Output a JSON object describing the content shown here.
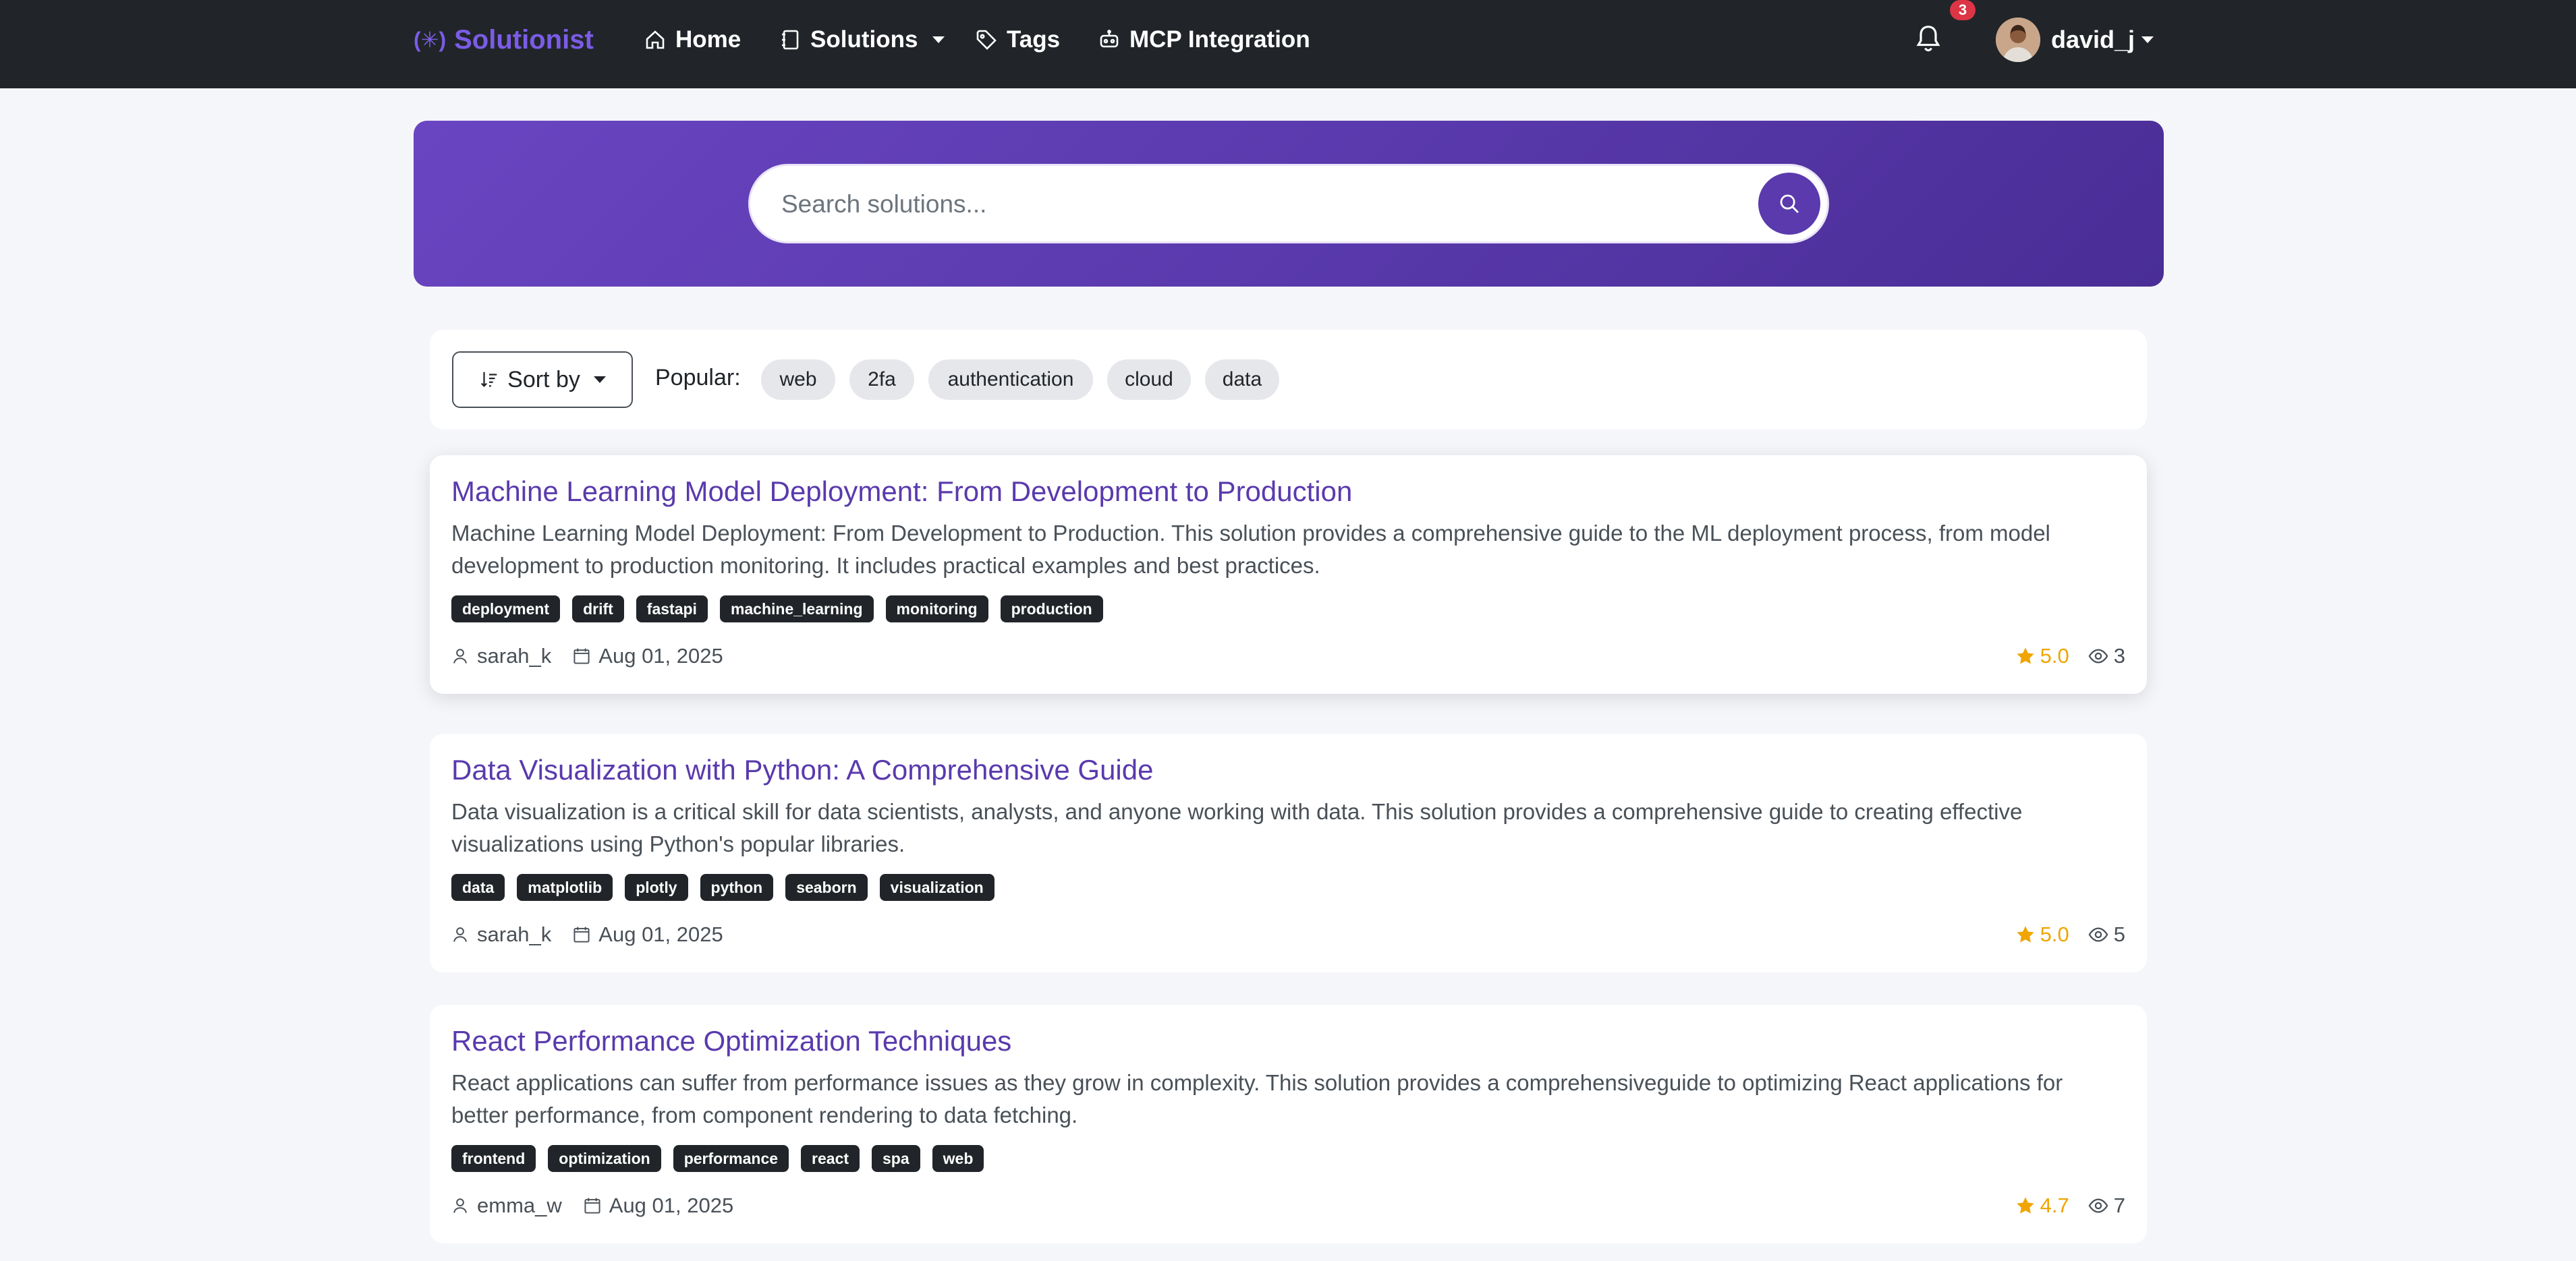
{
  "brand": {
    "name": "Solutionist"
  },
  "nav": {
    "items": [
      {
        "label": "Home",
        "icon": "home-icon"
      },
      {
        "label": "Solutions",
        "icon": "journal-icon"
      },
      {
        "label": "Tags",
        "icon": "tag-icon"
      },
      {
        "label": "MCP Integration",
        "icon": "robot-icon"
      }
    ],
    "notifications": "3",
    "username": "david_j"
  },
  "search": {
    "placeholder": "Search solutions..."
  },
  "filters": {
    "sort_label": "Sort by",
    "popular_label": "Popular:",
    "popular_tags": [
      "web",
      "2fa",
      "authentication",
      "cloud",
      "data"
    ]
  },
  "solutions": [
    {
      "title": "Machine Learning Model Deployment: From Development to Production",
      "description": "Machine Learning Model Deployment: From Development to Production. This solution provides a comprehensive guide to the ML deployment process, from model development to production monitoring. It includes practical examples and best practices.",
      "tags": [
        "deployment",
        "drift",
        "fastapi",
        "machine_learning",
        "monitoring",
        "production"
      ],
      "author": "sarah_k",
      "date": "Aug 01, 2025",
      "rating": "5.0",
      "views": "3"
    },
    {
      "title": "Data Visualization with Python: A Comprehensive Guide",
      "description": "Data visualization is a critical skill for data scientists, analysts, and anyone working with data. This solution provides a comprehensive guide to creating effective visualizations using Python's popular libraries.",
      "tags": [
        "data",
        "matplotlib",
        "plotly",
        "python",
        "seaborn",
        "visualization"
      ],
      "author": "sarah_k",
      "date": "Aug 01, 2025",
      "rating": "5.0",
      "views": "5"
    },
    {
      "title": "React Performance Optimization Techniques",
      "description": "React applications can suffer from performance issues as they grow in complexity. This solution provides a comprehensiveguide to optimizing React applications for better performance, from component rendering to data fetching.",
      "tags": [
        "frontend",
        "optimization",
        "performance",
        "react",
        "spa",
        "web"
      ],
      "author": "emma_w",
      "date": "Aug 01, 2025",
      "rating": "4.7",
      "views": "7"
    }
  ],
  "colors": {
    "accent": "#5a3aad",
    "navbar": "#212529",
    "star": "#f0a500"
  }
}
